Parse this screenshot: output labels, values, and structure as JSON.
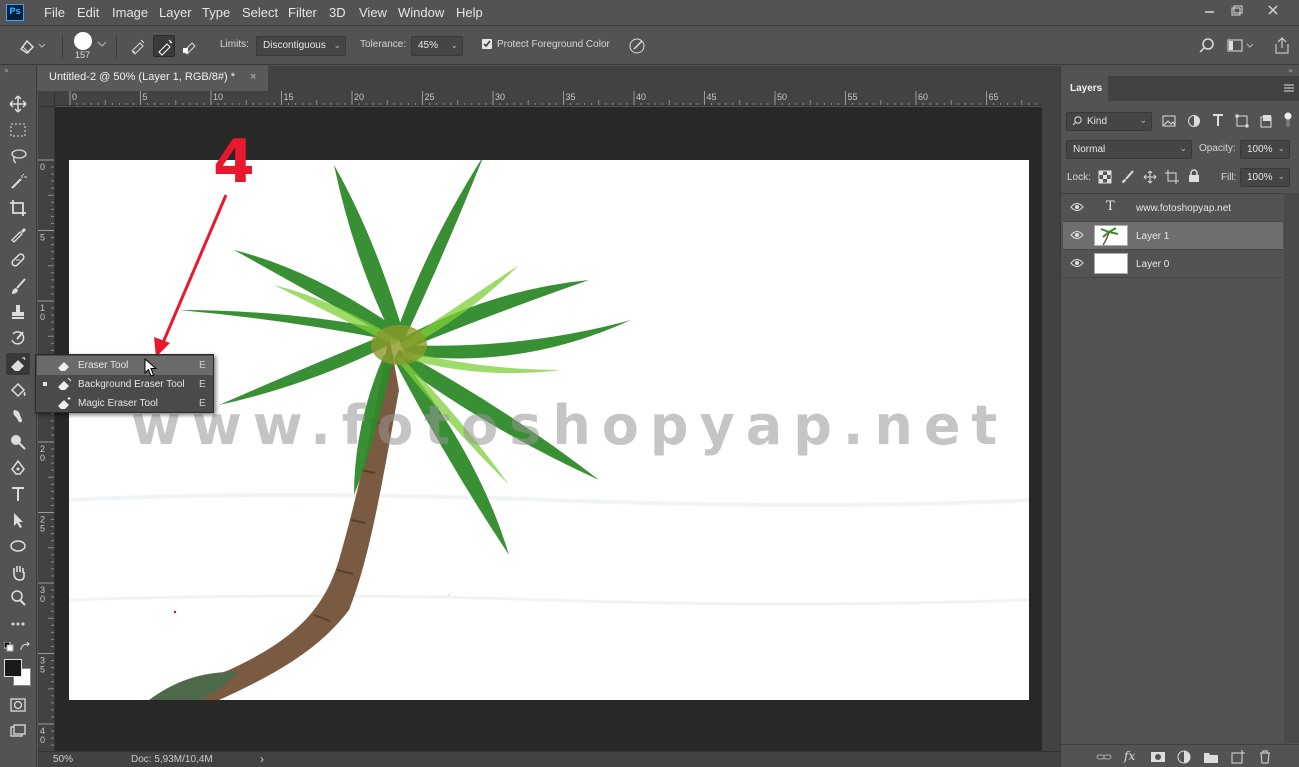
{
  "app": {
    "logo": "Ps",
    "menu": [
      "File",
      "Edit",
      "Image",
      "Layer",
      "Type",
      "Select",
      "Filter",
      "3D",
      "View",
      "Window",
      "Help"
    ],
    "window_controls": [
      "minimize",
      "restore",
      "close"
    ]
  },
  "options": {
    "brush_size": "157",
    "limits_label": "Limits:",
    "limits_value": "Discontiguous",
    "tolerance_label": "Tolerance:",
    "tolerance_value": "45%",
    "protect_label": "Protect Foreground Color",
    "protect_checked": true
  },
  "document": {
    "tab_title": "Untitled-2 @ 50% (Layer 1, RGB/8#) *",
    "tab_close": "×",
    "ruler_top": [
      "0",
      "5",
      "10",
      "15",
      "20",
      "25",
      "30",
      "35",
      "40",
      "45",
      "50",
      "55",
      "60",
      "65"
    ],
    "ruler_left": [
      "0",
      "5",
      "1\n0",
      "1\n5",
      "2\n0",
      "2\n5",
      "3\n0",
      "3\n5",
      "4\n0"
    ],
    "watermark": "www.fotoshopyap.net",
    "annotation_number": "4"
  },
  "status": {
    "zoom": "50%",
    "doc_info": "Doc: 5,93M/10,4M",
    "arrow": "›"
  },
  "flyout": {
    "items": [
      {
        "label": "Eraser Tool",
        "shortcut": "E",
        "hover": true,
        "active": false
      },
      {
        "label": "Background Eraser Tool",
        "shortcut": "E",
        "hover": false,
        "active": true
      },
      {
        "label": "Magic Eraser Tool",
        "shortcut": "E",
        "hover": false,
        "active": false
      }
    ]
  },
  "layers_panel": {
    "tab_label": "Layers",
    "filter_kind": "Kind",
    "blend_mode": "Normal",
    "opacity_label": "Opacity:",
    "opacity_value": "100%",
    "lock_label": "Lock:",
    "fill_label": "Fill:",
    "fill_value": "100%",
    "layers": [
      {
        "name": "www.fotoshopyap.net",
        "type": "text",
        "selected": false
      },
      {
        "name": "Layer 1",
        "type": "image",
        "selected": true
      },
      {
        "name": "Layer 0",
        "type": "fill",
        "selected": false
      }
    ]
  },
  "colors": {
    "ui_bg": "#535353",
    "annotation_red": "#e8192c",
    "ps_blue": "#31a8ff"
  }
}
